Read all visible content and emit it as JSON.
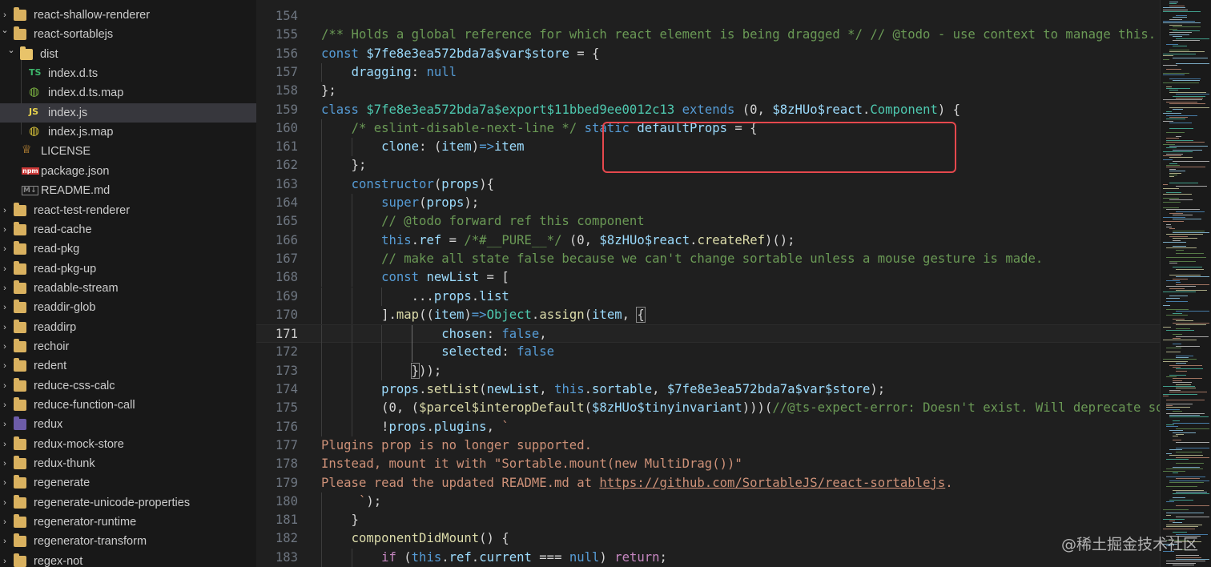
{
  "sidebar": {
    "items": [
      {
        "label": "react-shallow-renderer",
        "kind": "folder",
        "expanded": false,
        "depth": 0,
        "icon": "folder-icon"
      },
      {
        "label": "react-sortablejs",
        "kind": "folder",
        "expanded": true,
        "depth": 0,
        "icon": "folder-icon"
      },
      {
        "label": "dist",
        "kind": "folder",
        "expanded": true,
        "depth": 1,
        "icon": "folder-open-icon"
      },
      {
        "label": "index.d.ts",
        "kind": "file",
        "depth": 2,
        "icon": "typescript-file-icon",
        "glyph": "TS",
        "glyph_color": "#3db56b"
      },
      {
        "label": "index.d.ts.map",
        "kind": "file",
        "depth": 2,
        "icon": "globe-map-icon",
        "glyph": "◍",
        "glyph_color": "#7cb342"
      },
      {
        "label": "index.js",
        "kind": "file",
        "depth": 2,
        "icon": "javascript-file-icon",
        "glyph": "JS",
        "glyph_color": "#e8d44d",
        "selected": true
      },
      {
        "label": "index.js.map",
        "kind": "file",
        "depth": 2,
        "icon": "globe-map-icon",
        "glyph": "◍",
        "glyph_color": "#d8c33a"
      },
      {
        "label": "LICENSE",
        "kind": "file",
        "depth": 1,
        "icon": "license-icon",
        "glyph": "♕",
        "glyph_color": "#e4a13c"
      },
      {
        "label": "package.json",
        "kind": "file",
        "depth": 1,
        "icon": "npm-icon",
        "glyph": "npm",
        "glyph_color": "#cb3837"
      },
      {
        "label": "README.md",
        "kind": "file",
        "depth": 1,
        "icon": "markdown-icon",
        "glyph": "M↓",
        "glyph_color": "#8a8a8a"
      },
      {
        "label": "react-test-renderer",
        "kind": "folder",
        "expanded": false,
        "depth": 0,
        "icon": "folder-icon"
      },
      {
        "label": "read-cache",
        "kind": "folder",
        "expanded": false,
        "depth": 0,
        "icon": "folder-icon"
      },
      {
        "label": "read-pkg",
        "kind": "folder",
        "expanded": false,
        "depth": 0,
        "icon": "folder-icon"
      },
      {
        "label": "read-pkg-up",
        "kind": "folder",
        "expanded": false,
        "depth": 0,
        "icon": "folder-icon"
      },
      {
        "label": "readable-stream",
        "kind": "folder",
        "expanded": false,
        "depth": 0,
        "icon": "folder-icon"
      },
      {
        "label": "readdir-glob",
        "kind": "folder",
        "expanded": false,
        "depth": 0,
        "icon": "folder-icon"
      },
      {
        "label": "readdirp",
        "kind": "folder",
        "expanded": false,
        "depth": 0,
        "icon": "folder-icon"
      },
      {
        "label": "rechoir",
        "kind": "folder",
        "expanded": false,
        "depth": 0,
        "icon": "folder-icon"
      },
      {
        "label": "redent",
        "kind": "folder",
        "expanded": false,
        "depth": 0,
        "icon": "folder-icon"
      },
      {
        "label": "reduce-css-calc",
        "kind": "folder",
        "expanded": false,
        "depth": 0,
        "icon": "folder-icon"
      },
      {
        "label": "reduce-function-call",
        "kind": "folder",
        "expanded": false,
        "depth": 0,
        "icon": "folder-icon"
      },
      {
        "label": "redux",
        "kind": "folder",
        "expanded": false,
        "depth": 0,
        "icon": "folder-redux-icon"
      },
      {
        "label": "redux-mock-store",
        "kind": "folder",
        "expanded": false,
        "depth": 0,
        "icon": "folder-icon"
      },
      {
        "label": "redux-thunk",
        "kind": "folder",
        "expanded": false,
        "depth": 0,
        "icon": "folder-icon"
      },
      {
        "label": "regenerate",
        "kind": "folder",
        "expanded": false,
        "depth": 0,
        "icon": "folder-icon"
      },
      {
        "label": "regenerate-unicode-properties",
        "kind": "folder",
        "expanded": false,
        "depth": 0,
        "icon": "folder-icon"
      },
      {
        "label": "regenerator-runtime",
        "kind": "folder",
        "expanded": false,
        "depth": 0,
        "icon": "folder-icon"
      },
      {
        "label": "regenerator-transform",
        "kind": "folder",
        "expanded": false,
        "depth": 0,
        "icon": "folder-icon"
      },
      {
        "label": "regex-not",
        "kind": "folder",
        "expanded": false,
        "depth": 0,
        "icon": "folder-icon"
      }
    ]
  },
  "editor": {
    "active_line": 171,
    "lines": [
      {
        "num": "154",
        "indent": 0,
        "tokens": []
      },
      {
        "num": "155",
        "indent": 0,
        "tokens": [
          [
            "com",
            "/** Holds a global reference for which react element is being dragged */ // @todo - use context to manage this."
          ]
        ]
      },
      {
        "num": "156",
        "indent": 0,
        "tokens": [
          [
            "kw",
            "const "
          ],
          [
            "var",
            "$7fe8e3ea572bda7a$var$store"
          ],
          [
            "pun",
            " = {"
          ]
        ]
      },
      {
        "num": "157",
        "indent": 1,
        "tokens": [
          [
            "pun",
            "    "
          ],
          [
            "var",
            "dragging"
          ],
          [
            "pun",
            ": "
          ],
          [
            "kw",
            "null"
          ]
        ]
      },
      {
        "num": "158",
        "indent": 0,
        "tokens": [
          [
            "pun",
            "};"
          ]
        ]
      },
      {
        "num": "159",
        "indent": 0,
        "tokens": [
          [
            "kw",
            "class "
          ],
          [
            "cls",
            "$7fe8e3ea572bda7a$export$11bbed9ee0012c13"
          ],
          [
            "kw",
            " extends "
          ],
          [
            "pun",
            "(0, "
          ],
          [
            "var",
            "$8zHUo$react"
          ],
          [
            "pun",
            "."
          ],
          [
            "cls",
            "Component"
          ],
          [
            "pun",
            ") {"
          ]
        ]
      },
      {
        "num": "160",
        "indent": 1,
        "tokens": [
          [
            "pun",
            "    "
          ],
          [
            "com",
            "/* eslint-disable-next-line */"
          ],
          [
            "pun",
            " "
          ],
          [
            "kw",
            "static "
          ],
          [
            "var",
            "defaultProps"
          ],
          [
            "pun",
            " = {"
          ]
        ]
      },
      {
        "num": "161",
        "indent": 2,
        "tokens": [
          [
            "pun",
            "        "
          ],
          [
            "var",
            "clone"
          ],
          [
            "pun",
            ": ("
          ],
          [
            "var",
            "item"
          ],
          [
            "pun",
            ")"
          ],
          [
            "kw",
            "=>"
          ],
          [
            "var",
            "item"
          ]
        ]
      },
      {
        "num": "162",
        "indent": 1,
        "tokens": [
          [
            "pun",
            "    };"
          ]
        ]
      },
      {
        "num": "163",
        "indent": 1,
        "tokens": [
          [
            "pun",
            "    "
          ],
          [
            "kw",
            "constructor"
          ],
          [
            "pun",
            "("
          ],
          [
            "var",
            "props"
          ],
          [
            "pun",
            "){"
          ]
        ]
      },
      {
        "num": "164",
        "indent": 2,
        "tokens": [
          [
            "pun",
            "        "
          ],
          [
            "kw",
            "super"
          ],
          [
            "pun",
            "("
          ],
          [
            "var",
            "props"
          ],
          [
            "pun",
            ");"
          ]
        ]
      },
      {
        "num": "165",
        "indent": 2,
        "tokens": [
          [
            "pun",
            "        "
          ],
          [
            "com",
            "// @todo forward ref this component"
          ]
        ]
      },
      {
        "num": "166",
        "indent": 2,
        "tokens": [
          [
            "pun",
            "        "
          ],
          [
            "kw",
            "this"
          ],
          [
            "pun",
            "."
          ],
          [
            "var",
            "ref"
          ],
          [
            "pun",
            " = "
          ],
          [
            "com",
            "/*#__PURE__*/"
          ],
          [
            "pun",
            " (0, "
          ],
          [
            "var",
            "$8zHUo$react"
          ],
          [
            "pun",
            "."
          ],
          [
            "fn",
            "createRef"
          ],
          [
            "pun",
            ")();"
          ]
        ]
      },
      {
        "num": "167",
        "indent": 2,
        "tokens": [
          [
            "pun",
            "        "
          ],
          [
            "com",
            "// make all state false because we can't change sortable unless a mouse gesture is made."
          ]
        ]
      },
      {
        "num": "168",
        "indent": 2,
        "tokens": [
          [
            "pun",
            "        "
          ],
          [
            "kw",
            "const "
          ],
          [
            "var",
            "newList"
          ],
          [
            "pun",
            " = ["
          ]
        ]
      },
      {
        "num": "169",
        "indent": 3,
        "tokens": [
          [
            "pun",
            "            ..."
          ],
          [
            "var",
            "props"
          ],
          [
            "pun",
            "."
          ],
          [
            "var",
            "list"
          ]
        ]
      },
      {
        "num": "170",
        "indent": 2,
        "tokens": [
          [
            "pun",
            "        ]."
          ],
          [
            "fn",
            "map"
          ],
          [
            "pun",
            "(("
          ],
          [
            "var",
            "item"
          ],
          [
            "pun",
            ")"
          ],
          [
            "kw",
            "=>"
          ],
          [
            "cls",
            "Object"
          ],
          [
            "pun",
            "."
          ],
          [
            "fn",
            "assign"
          ],
          [
            "pun",
            "("
          ],
          [
            "var",
            "item"
          ],
          [
            "pun",
            ", "
          ],
          [
            "box",
            "{"
          ]
        ]
      },
      {
        "num": "171",
        "indent": 4,
        "tokens": [
          [
            "pun",
            "                "
          ],
          [
            "var",
            "chosen"
          ],
          [
            "pun",
            ": "
          ],
          [
            "bool",
            "false"
          ],
          [
            "pun",
            ","
          ]
        ]
      },
      {
        "num": "172",
        "indent": 4,
        "tokens": [
          [
            "pun",
            "                "
          ],
          [
            "var",
            "selected"
          ],
          [
            "pun",
            ": "
          ],
          [
            "bool",
            "false"
          ]
        ]
      },
      {
        "num": "173",
        "indent": 3,
        "tokens": [
          [
            "pun",
            "            "
          ],
          [
            "box",
            "}"
          ],
          [
            "pun",
            "));"
          ]
        ]
      },
      {
        "num": "174",
        "indent": 2,
        "tokens": [
          [
            "pun",
            "        "
          ],
          [
            "var",
            "props"
          ],
          [
            "pun",
            "."
          ],
          [
            "fn",
            "setList"
          ],
          [
            "pun",
            "("
          ],
          [
            "var",
            "newList"
          ],
          [
            "pun",
            ", "
          ],
          [
            "kw",
            "this"
          ],
          [
            "pun",
            "."
          ],
          [
            "var",
            "sortable"
          ],
          [
            "pun",
            ", "
          ],
          [
            "var",
            "$7fe8e3ea572bda7a$var$store"
          ],
          [
            "pun",
            ");"
          ]
        ]
      },
      {
        "num": "175",
        "indent": 2,
        "tokens": [
          [
            "pun",
            "        (0, ("
          ],
          [
            "fn",
            "$parcel$interopDefault"
          ],
          [
            "pun",
            "("
          ],
          [
            "var",
            "$8zHUo$tinyinvariant"
          ],
          [
            "pun",
            ")))("
          ],
          [
            "com",
            "//@ts-expect-error: Doesn't exist. Will deprecate so"
          ]
        ]
      },
      {
        "num": "176",
        "indent": 2,
        "tokens": [
          [
            "pun",
            "        !"
          ],
          [
            "var",
            "props"
          ],
          [
            "pun",
            "."
          ],
          [
            "var",
            "plugins"
          ],
          [
            "pun",
            ", "
          ],
          [
            "str",
            "`"
          ]
        ]
      },
      {
        "num": "177",
        "indent": 0,
        "tokens": [
          [
            "str",
            "Plugins prop is no longer supported."
          ]
        ]
      },
      {
        "num": "178",
        "indent": 0,
        "tokens": [
          [
            "str",
            "Instead, mount it with \"Sortable.mount(new MultiDrag())\""
          ]
        ]
      },
      {
        "num": "179",
        "indent": 0,
        "tokens": [
          [
            "str",
            "Please read the updated README.md at "
          ],
          [
            "url",
            "https://github.com/SortableJS/react-sortablejs"
          ],
          [
            "str",
            "."
          ]
        ]
      },
      {
        "num": "180",
        "indent": 1,
        "tokens": [
          [
            "pun",
            "     "
          ],
          [
            "str",
            "`"
          ],
          [
            "pun",
            ");"
          ]
        ]
      },
      {
        "num": "181",
        "indent": 1,
        "tokens": [
          [
            "pun",
            "    }"
          ]
        ]
      },
      {
        "num": "182",
        "indent": 1,
        "tokens": [
          [
            "pun",
            "    "
          ],
          [
            "fn",
            "componentDidMount"
          ],
          [
            "pun",
            "() {"
          ]
        ]
      },
      {
        "num": "183",
        "indent": 2,
        "tokens": [
          [
            "pun",
            "        "
          ],
          [
            "ctl",
            "if"
          ],
          [
            "pun",
            " ("
          ],
          [
            "kw",
            "this"
          ],
          [
            "pun",
            "."
          ],
          [
            "var",
            "ref"
          ],
          [
            "pun",
            "."
          ],
          [
            "var",
            "current"
          ],
          [
            "pun",
            " === "
          ],
          [
            "kw",
            "null"
          ],
          [
            "pun",
            ") "
          ],
          [
            "ctl",
            "return"
          ],
          [
            "pun",
            ";"
          ]
        ]
      }
    ]
  },
  "colors": {
    "highlight_box": "#e5484d",
    "selected_row": "#37373d",
    "editor_bg": "#1f1f1f",
    "sidebar_bg": "#181818"
  },
  "watermark": "@稀土掘金技术社区"
}
